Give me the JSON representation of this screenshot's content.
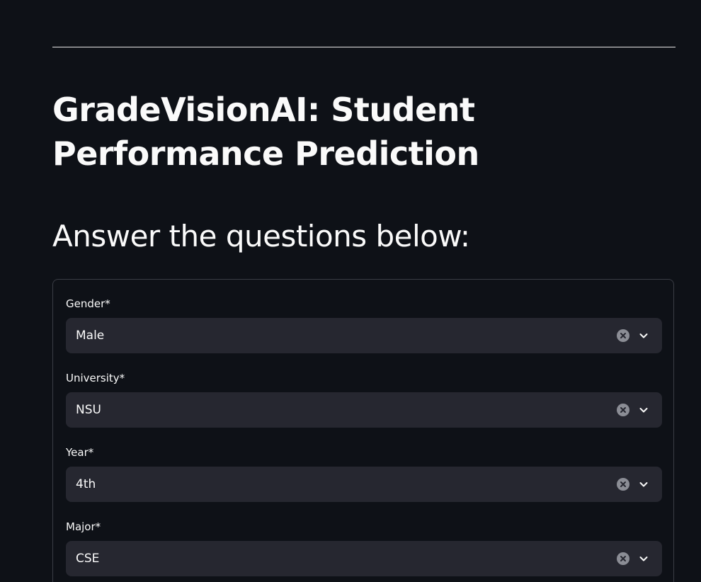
{
  "header": {
    "title": "GradeVisionAI: Student Performance Prediction",
    "subtitle": "Answer the questions below:"
  },
  "form": {
    "fields": [
      {
        "label": "Gender*",
        "value": "Male"
      },
      {
        "label": "University*",
        "value": "NSU"
      },
      {
        "label": "Year*",
        "value": "4th"
      },
      {
        "label": "Major*",
        "value": "CSE"
      }
    ]
  },
  "icons": {
    "clear": "clear-circle-icon",
    "dropdown": "chevron-down-icon"
  },
  "colors": {
    "background": "#0e1117",
    "select_background": "#262730",
    "text": "#fafafa",
    "icon_clear": "#8b8d95"
  }
}
